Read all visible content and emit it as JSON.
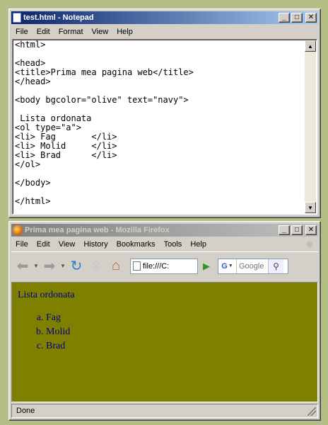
{
  "notepad": {
    "title": "test.html - Notepad",
    "menu": [
      "File",
      "Edit",
      "Format",
      "View",
      "Help"
    ],
    "content": "<html>\n\n<head>\n<title>Prima mea pagina web</title>\n</head>\n\n<body bgcolor=\"olive\" text=\"navy\">\n\n Lista ordonata\n<ol type=\"a\">\n<li> Fag       </li>\n<li> Molid     </li>\n<li> Brad      </li>\n</ol>\n\n</body>\n\n</html>"
  },
  "firefox": {
    "title": "Prima mea pagina web - Mozilla Firefox",
    "menu": [
      "File",
      "Edit",
      "View",
      "History",
      "Bookmarks",
      "Tools",
      "Help"
    ],
    "url": "file:///C:",
    "search_engine": "G",
    "search_placeholder": "Google",
    "page": {
      "heading": "Lista ordonata",
      "items": [
        "Fag",
        "Molid",
        "Brad"
      ],
      "bgcolor": "#808000",
      "textcolor": "#000080"
    },
    "status": "Done"
  }
}
